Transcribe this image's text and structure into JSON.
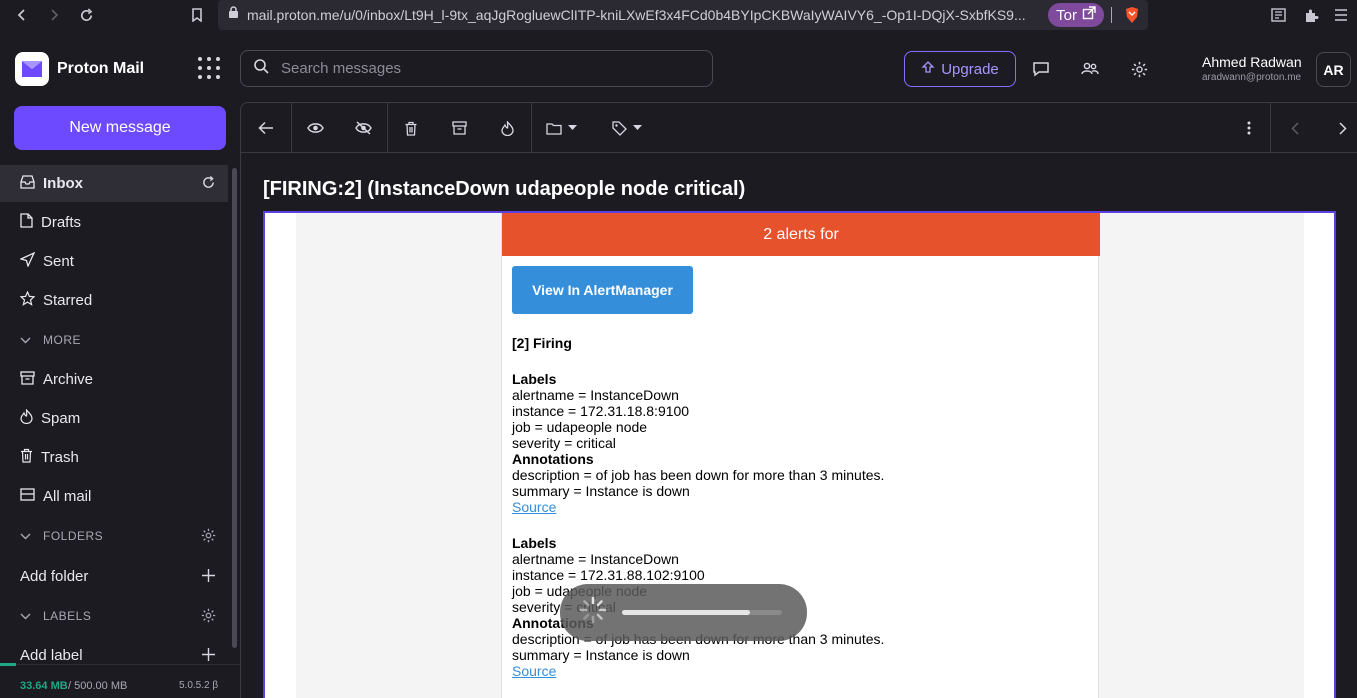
{
  "browser": {
    "url": "mail.proton.me/u/0/inbox/Lt9H_l-9tx_aqJgRogluewClITP-kniLXwEf3x4FCd0b4BYIpCKBWaIyWAIVY6_-Op1I-DQjX-SxbfKS9...",
    "tor_label": "Tor"
  },
  "header": {
    "brand": "Proton Mail",
    "search_placeholder": "Search messages",
    "upgrade_label": "Upgrade",
    "user_name": "Ahmed Radwan",
    "user_email": "aradwann@proton.me",
    "avatar_initials": "AR"
  },
  "sidebar": {
    "new_message": "New message",
    "items": [
      {
        "label": "Inbox",
        "icon": "inbox-icon"
      },
      {
        "label": "Drafts",
        "icon": "drafts-icon"
      },
      {
        "label": "Sent",
        "icon": "sent-icon"
      },
      {
        "label": "Starred",
        "icon": "star-icon"
      }
    ],
    "more_label": "MORE",
    "more_items": [
      {
        "label": "Archive",
        "icon": "archive-icon"
      },
      {
        "label": "Spam",
        "icon": "spam-icon"
      },
      {
        "label": "Trash",
        "icon": "trash-icon"
      },
      {
        "label": "All mail",
        "icon": "all-mail-icon"
      }
    ],
    "folders_label": "FOLDERS",
    "add_folder": "Add folder",
    "labels_label": "LABELS",
    "add_label": "Add label",
    "storage_used": "33.64 MB",
    "storage_total": "/ 500.00 MB",
    "storage_fraction": 0.067,
    "version": "5.0.5.2 β"
  },
  "message": {
    "subject": "[FIRING:2] (InstanceDown udapeople node critical)",
    "alert_header": "2 alerts for",
    "button": "View In AlertManager",
    "firing": "[2] Firing",
    "alerts": [
      {
        "labels_title": "Labels",
        "alertname": "alertname = InstanceDown",
        "instance": "instance = 172.31.18.8:9100",
        "job": "job = udapeople node",
        "severity": "severity = critical",
        "annotations_title": "Annotations",
        "description": "description = of job has been down for more than 3 minutes.",
        "summary": "summary = Instance is down",
        "source": "Source"
      },
      {
        "labels_title": "Labels",
        "alertname": "alertname = InstanceDown",
        "instance": "instance = 172.31.88.102:9100",
        "job": "job = udapeople node",
        "severity": "severity = critical",
        "annotations_title": "Annotations",
        "description": "description = of job has been down for more than 3 minutes.",
        "summary": "summary = Instance is down",
        "source": "Source"
      }
    ]
  },
  "loader": {
    "progress": 0.8
  },
  "colors": {
    "accent": "#6d4aff",
    "alert_header": "#e6522c",
    "alert_button": "#348eda",
    "storage": "#1ea885"
  }
}
